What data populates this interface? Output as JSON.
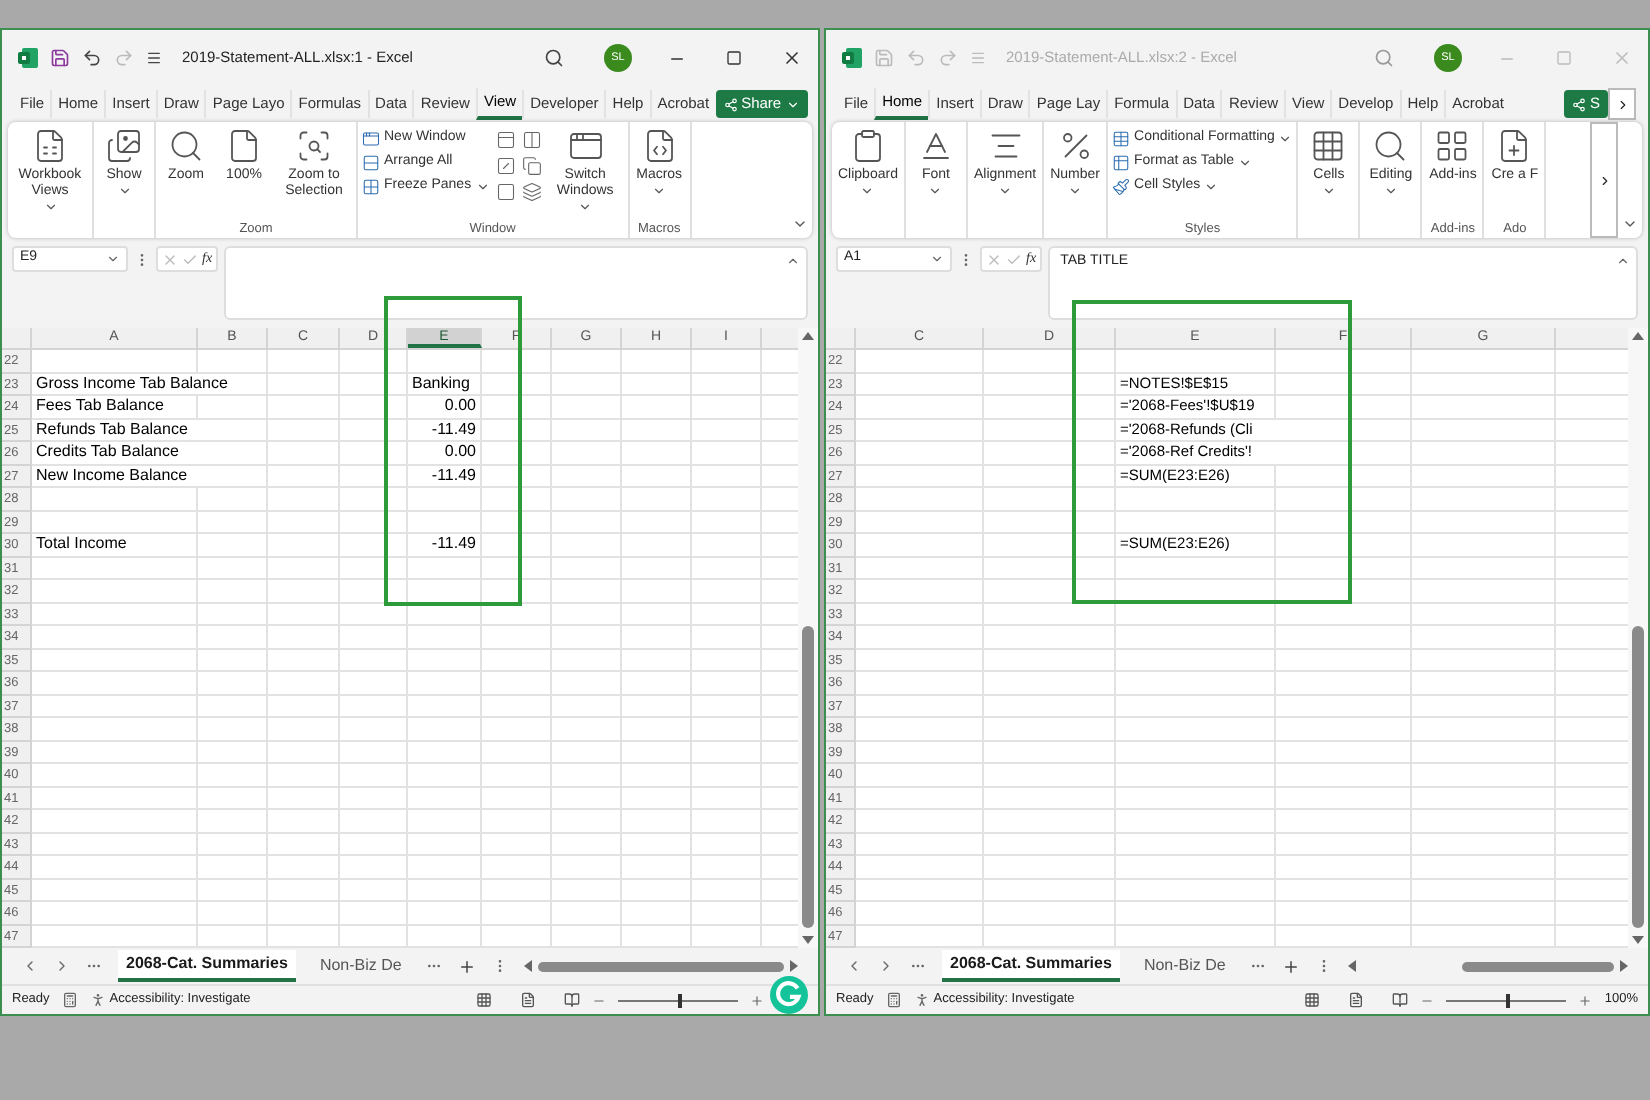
{
  "windows": [
    {
      "title": "2019-Statement-ALL.xlsx:1 - Excel",
      "active": true,
      "avatar": "SL",
      "share": {
        "label": "Share",
        "menu": true
      },
      "tabs": [
        {
          "label": "File",
          "selected": false
        },
        {
          "label": "Home",
          "selected": false
        },
        {
          "label": "Insert",
          "selected": false
        },
        {
          "label": "Draw",
          "selected": false
        },
        {
          "label": "Page Layo",
          "selected": false
        },
        {
          "label": "Formulas",
          "selected": false
        },
        {
          "label": "Data",
          "selected": false
        },
        {
          "label": "Review",
          "selected": false
        },
        {
          "label": "View",
          "selected": true
        },
        {
          "label": "Developer",
          "selected": false
        },
        {
          "label": "Help",
          "selected": false
        },
        {
          "label": "Acrobat",
          "selected": false
        }
      ],
      "ribbon": [
        {
          "items": [
            {
              "kind": "large",
              "label": "Workbook Views",
              "menu": true
            }
          ]
        },
        {
          "items": [
            {
              "kind": "large",
              "label": "Show",
              "menu": true
            }
          ]
        },
        {
          "label": "Zoom",
          "items": [
            {
              "kind": "large",
              "label": "Zoom",
              "menu": false
            },
            {
              "kind": "large",
              "label": "100%",
              "menu": false
            },
            {
              "kind": "large",
              "label": "Zoom to Selection",
              "menu": false
            }
          ]
        },
        {
          "label": "Window",
          "items": [
            {
              "kind": "small",
              "label": "New Window",
              "menu": false
            },
            {
              "kind": "small",
              "label": "Arrange All",
              "menu": false
            },
            {
              "kind": "small",
              "label": "Freeze Panes",
              "menu": true
            },
            {
              "kind": "icon"
            },
            {
              "kind": "icon"
            },
            {
              "kind": "icon"
            },
            {
              "kind": "icon"
            },
            {
              "kind": "icon"
            },
            {
              "kind": "icon"
            },
            {
              "kind": "large",
              "label": "Switch Windows",
              "menu": true
            }
          ]
        },
        {
          "label": "Macros",
          "items": [
            {
              "kind": "large",
              "label": "Macros",
              "menu": true
            }
          ]
        }
      ],
      "name_box": "E9",
      "fx": "fx",
      "columns": [
        {
          "label": "A",
          "selected": false
        },
        {
          "label": "B",
          "selected": false
        },
        {
          "label": "C",
          "selected": false
        },
        {
          "label": "D",
          "selected": false
        },
        {
          "label": "E",
          "selected": true
        },
        {
          "label": "F",
          "selected": false
        },
        {
          "label": "G",
          "selected": false
        },
        {
          "label": "H",
          "selected": false
        },
        {
          "label": "I",
          "selected": false
        }
      ],
      "rows": [
        {
          "number": "22"
        },
        {
          "number": "23",
          "cells": {
            "A": {
              "text": "Gross Income Tab Balance",
              "kind": "text"
            },
            "E": {
              "text": "Banking",
              "kind": "text"
            }
          }
        },
        {
          "number": "24",
          "cells": {
            "A": {
              "text": "Fees Tab Balance",
              "kind": "text"
            },
            "E": {
              "text": "0.00",
              "kind": "number"
            }
          }
        },
        {
          "number": "25",
          "cells": {
            "A": {
              "text": "Refunds Tab Balance",
              "kind": "text"
            },
            "E": {
              "text": "-11.49",
              "kind": "number"
            }
          }
        },
        {
          "number": "26",
          "cells": {
            "A": {
              "text": "Credits Tab Balance",
              "kind": "text"
            },
            "E": {
              "text": "0.00",
              "kind": "number"
            }
          }
        },
        {
          "number": "27",
          "cells": {
            "A": {
              "text": "New Income Balance",
              "kind": "text"
            },
            "E": {
              "text": "-11.49",
              "kind": "number"
            }
          }
        },
        {
          "number": "28"
        },
        {
          "number": "29"
        },
        {
          "number": "30",
          "cells": {
            "A": {
              "text": "Total Income",
              "kind": "text"
            },
            "E": {
              "text": "-11.49",
              "kind": "number"
            }
          }
        },
        {
          "number": "31"
        },
        {
          "number": "32"
        },
        {
          "number": "33"
        },
        {
          "number": "34"
        },
        {
          "number": "35"
        },
        {
          "number": "36"
        },
        {
          "number": "37"
        },
        {
          "number": "38"
        },
        {
          "number": "39"
        },
        {
          "number": "40"
        },
        {
          "number": "41"
        },
        {
          "number": "42"
        },
        {
          "number": "43"
        },
        {
          "number": "44"
        },
        {
          "number": "45"
        },
        {
          "number": "46"
        },
        {
          "number": "47"
        }
      ],
      "annotation_box": true,
      "sheet_tabs": [
        {
          "label": "2068-Cat. Summaries",
          "selected": true
        },
        {
          "label": "Non-Biz De",
          "selected": false
        }
      ],
      "status": {
        "ready": "Ready",
        "accessibility": "Accessibility: Investigate",
        "zoom": {
          "level": 0.5
        }
      },
      "grammarly": true
    },
    {
      "title": "2019-Statement-ALL.xlsx:2 - Excel",
      "active": false,
      "avatar": "SL",
      "share": {
        "label": "S",
        "menu": false
      },
      "ribbon_overflow": true,
      "tabs": [
        {
          "label": "File",
          "selected": false
        },
        {
          "label": "Home",
          "selected": true
        },
        {
          "label": "Insert",
          "selected": false
        },
        {
          "label": "Draw",
          "selected": false
        },
        {
          "label": "Page Lay",
          "selected": false
        },
        {
          "label": "Formula",
          "selected": false
        },
        {
          "label": "Data",
          "selected": false
        },
        {
          "label": "Review",
          "selected": false
        },
        {
          "label": "View",
          "selected": false
        },
        {
          "label": "Develop",
          "selected": false
        },
        {
          "label": "Help",
          "selected": false
        },
        {
          "label": "Acrobat",
          "selected": false
        }
      ],
      "ribbon": [
        {
          "items": [
            {
              "kind": "large",
              "label": "Clipboard",
              "menu": true
            }
          ]
        },
        {
          "items": [
            {
              "kind": "large",
              "label": "Font",
              "menu": true
            }
          ]
        },
        {
          "items": [
            {
              "kind": "large",
              "label": "Alignment",
              "menu": true
            }
          ]
        },
        {
          "items": [
            {
              "kind": "large",
              "label": "Number",
              "menu": true
            }
          ]
        },
        {
          "label": "Styles",
          "items": [
            {
              "kind": "small",
              "label": "Conditional Formatting",
              "menu": true
            },
            {
              "kind": "small",
              "label": "Format as Table",
              "menu": true
            },
            {
              "kind": "small",
              "label": "Cell Styles",
              "menu": true
            }
          ]
        },
        {
          "items": [
            {
              "kind": "large",
              "label": "Cells",
              "menu": true
            }
          ]
        },
        {
          "items": [
            {
              "kind": "large",
              "label": "Editing",
              "menu": true
            }
          ]
        },
        {
          "label": "Add-ins",
          "items": [
            {
              "kind": "large",
              "label": "Add-ins",
              "menu": false
            }
          ]
        },
        {
          "label": "Ado",
          "items": [
            {
              "kind": "large",
              "label": "Cre a F",
              "menu": false
            }
          ]
        }
      ],
      "name_box": "A1",
      "fx": "fx",
      "formula": "TAB TITLE",
      "columns": [
        {
          "label": "C",
          "selected": false
        },
        {
          "label": "D",
          "selected": false
        },
        {
          "label": "E",
          "selected": false
        },
        {
          "label": "F",
          "selected": false
        },
        {
          "label": "G",
          "selected": false
        }
      ],
      "rows": [
        {
          "number": "22"
        },
        {
          "number": "23",
          "cells": {
            "E": {
              "text": "=NOTES!$E$15",
              "kind": "text"
            }
          }
        },
        {
          "number": "24",
          "cells": {
            "E": {
              "text": "='2068-Fees'!$U$19",
              "kind": "text"
            }
          }
        },
        {
          "number": "25",
          "cells": {
            "E": {
              "text": "='2068-Refunds (Cli",
              "kind": "text"
            }
          }
        },
        {
          "number": "26",
          "cells": {
            "E": {
              "text": "='2068-Ref Credits'!",
              "kind": "text"
            }
          }
        },
        {
          "number": "27",
          "cells": {
            "E": {
              "text": "=SUM(E23:E26)",
              "kind": "text"
            }
          }
        },
        {
          "number": "28"
        },
        {
          "number": "29"
        },
        {
          "number": "30",
          "cells": {
            "E": {
              "text": "=SUM(E23:E26)",
              "kind": "text"
            }
          }
        },
        {
          "number": "31"
        },
        {
          "number": "32"
        },
        {
          "number": "33"
        },
        {
          "number": "34"
        },
        {
          "number": "35"
        },
        {
          "number": "36"
        },
        {
          "number": "37"
        },
        {
          "number": "38"
        },
        {
          "number": "39"
        },
        {
          "number": "40"
        },
        {
          "number": "41"
        },
        {
          "number": "42"
        },
        {
          "number": "43"
        },
        {
          "number": "44"
        },
        {
          "number": "45"
        },
        {
          "number": "46"
        },
        {
          "number": "47"
        }
      ],
      "annotation_box": true,
      "sheet_tabs": [
        {
          "label": "2068-Cat. Summaries",
          "selected": true
        },
        {
          "label": "Non-Biz De",
          "selected": false
        }
      ],
      "status": {
        "ready": "Ready",
        "accessibility": "Accessibility: Investigate",
        "zoom": {
          "level": 0.5,
          "label": "100%"
        }
      }
    }
  ]
}
